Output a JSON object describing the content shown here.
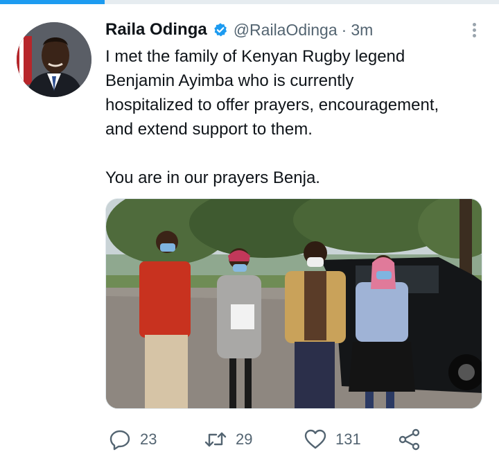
{
  "top_progress": {
    "fraction": 0.21,
    "color": "#1d9bf0"
  },
  "tweet": {
    "author_name": "Raila Odinga",
    "author_handle": "@RailaOdinga",
    "separator": "·",
    "time": "3m",
    "verified": true,
    "text": "I met the family of Kenyan Rugby legend\nBenjamin Ayimba who is currently\nhospitalized to offer prayers, encouragement,\nand extend support to them.\n\nYou are in our prayers Benja.",
    "media_alt": "photo"
  },
  "actions": {
    "reply_count": "23",
    "retweet_count": "29",
    "like_count": "131"
  },
  "icons": {
    "verified": "verified-badge-icon",
    "more": "more-vertical-icon",
    "reply": "reply-icon",
    "retweet": "retweet-icon",
    "like": "heart-icon",
    "share": "share-icon"
  },
  "colors": {
    "accent": "#1d9bf0",
    "text": "#0f1419",
    "muted": "#536471"
  }
}
